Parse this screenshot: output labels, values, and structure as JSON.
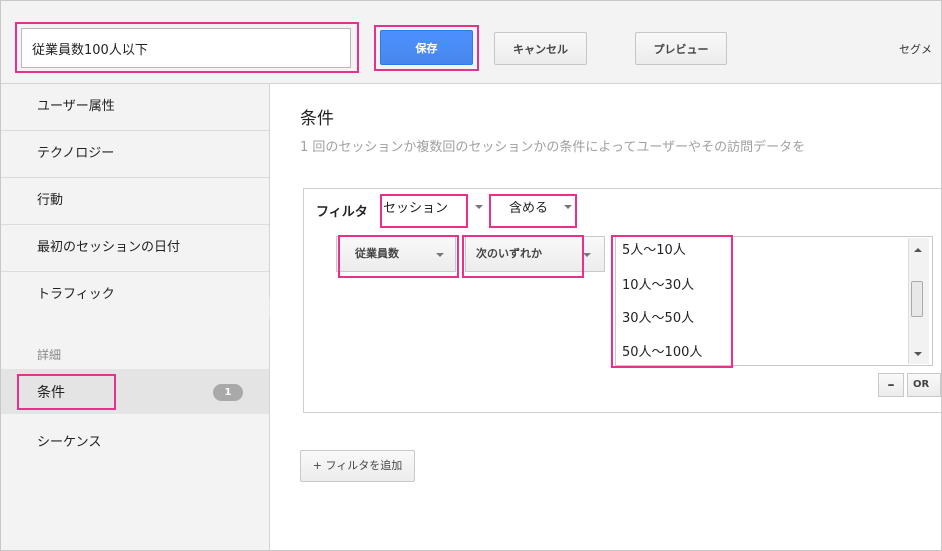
{
  "header": {
    "segment_name": "従業員数100人以下",
    "save_label": "保存",
    "cancel_label": "キャンセル",
    "preview_label": "プレビュー",
    "segment_text": "セグメ"
  },
  "sidebar": {
    "items": [
      {
        "label": "ユーザー属性"
      },
      {
        "label": "テクノロジー"
      },
      {
        "label": "行動"
      },
      {
        "label": "最初のセッションの日付"
      },
      {
        "label": "トラフィック"
      }
    ],
    "advanced_header": "詳細",
    "active": {
      "label": "条件",
      "badge": "1"
    },
    "sequence_label": "シーケンス"
  },
  "main": {
    "title": "条件",
    "description": "1 回のセッションか複数回のセッションかの条件によってユーザーやその訪問データを",
    "filter": {
      "label": "フィルタ",
      "scope_select": "セッション",
      "include_select": "含める",
      "dimension_select": "従業員数",
      "operator_select": "次のいずれか",
      "values": [
        "5人～10人",
        "10人～30人",
        "30人～50人",
        "50人～100人"
      ],
      "minus_label": "–",
      "or_label": "OR"
    },
    "add_filter_label": "+ フィルタを追加"
  },
  "colors": {
    "highlight": "#e8318a",
    "primary_button": "#4d90fe",
    "sidebar_bg": "#f3f3f3"
  }
}
